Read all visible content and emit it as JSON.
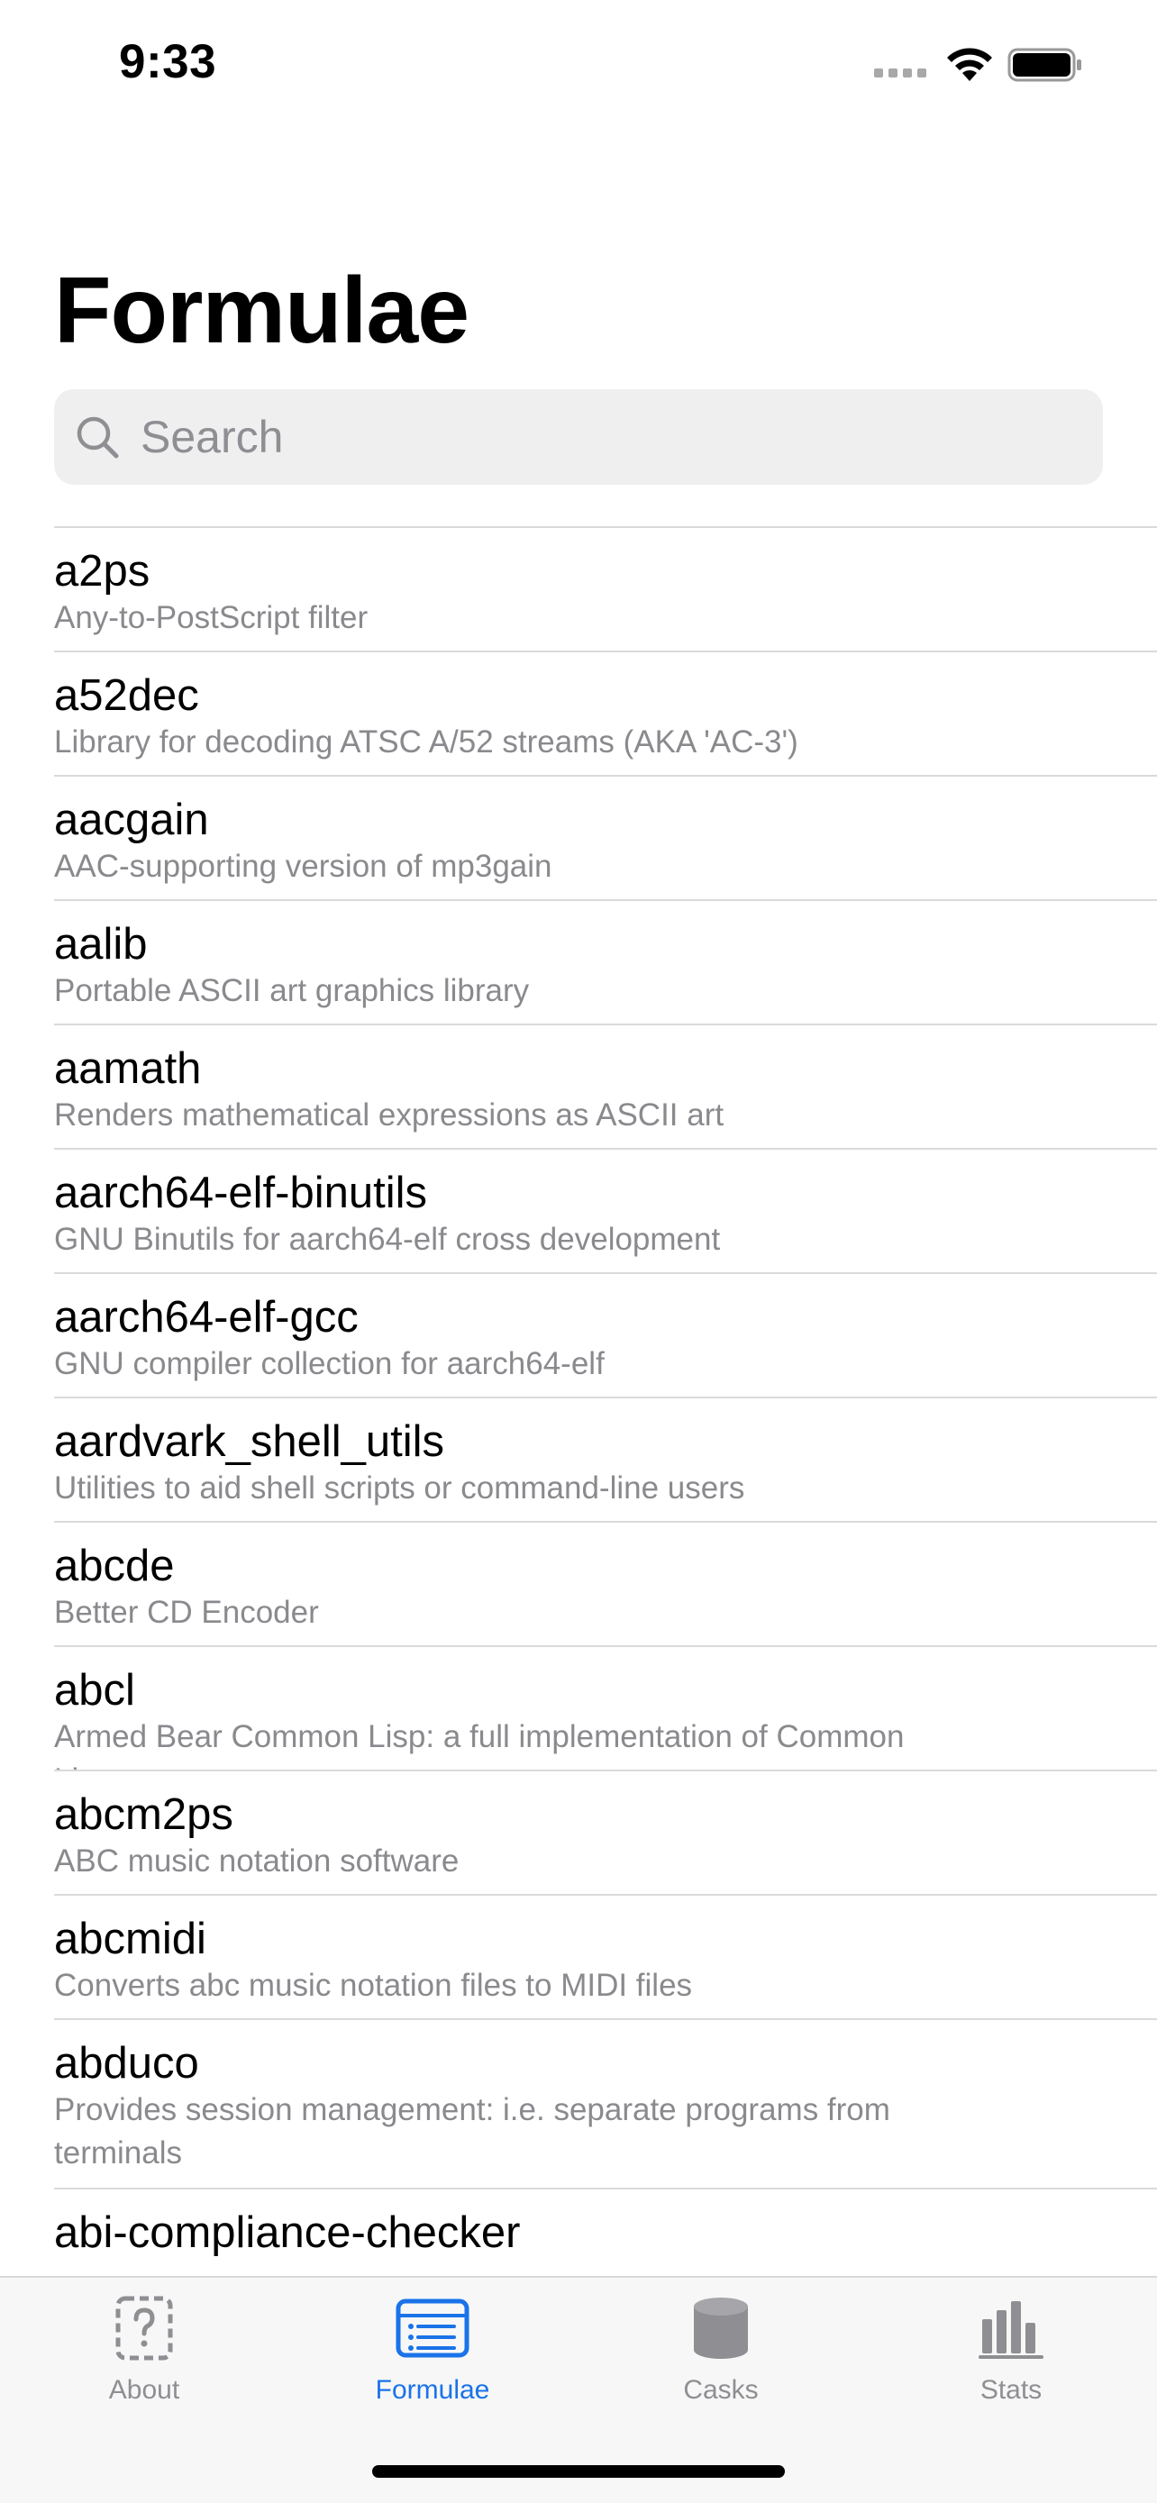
{
  "status_bar": {
    "time": "9:33"
  },
  "page": {
    "title": "Formulae"
  },
  "search": {
    "placeholder": "Search",
    "value": ""
  },
  "formulae": [
    {
      "name": "a2ps",
      "description": "Any-to-PostScript filter"
    },
    {
      "name": "a52dec",
      "description": "Library for decoding ATSC A/52 streams (AKA 'AC-3')"
    },
    {
      "name": "aacgain",
      "description": "AAC-supporting version of mp3gain"
    },
    {
      "name": "aalib",
      "description": "Portable ASCII art graphics library"
    },
    {
      "name": "aamath",
      "description": "Renders mathematical expressions as ASCII art"
    },
    {
      "name": "aarch64-elf-binutils",
      "description": "GNU Binutils for aarch64-elf cross development"
    },
    {
      "name": "aarch64-elf-gcc",
      "description": "GNU compiler collection for aarch64-elf"
    },
    {
      "name": "aardvark_shell_utils",
      "description": "Utilities to aid shell scripts or command-line users"
    },
    {
      "name": "abcde",
      "description": "Better CD Encoder"
    },
    {
      "name": "abcl",
      "description": "Armed Bear Common Lisp: a full implementation of Common Lisp"
    },
    {
      "name": "abcm2ps",
      "description": "ABC music notation software"
    },
    {
      "name": "abcmidi",
      "description": "Converts abc music notation files to MIDI files"
    },
    {
      "name": "abduco",
      "description": "Provides session management: i.e. separate programs from terminals"
    },
    {
      "name": "abi-compliance-checker",
      "description": ""
    }
  ],
  "tab_bar": {
    "active": "formulae",
    "accent_color": "#1a73e8",
    "inactive_color": "#8e8e93",
    "tabs": [
      {
        "id": "about",
        "label": "About",
        "icon": "question-mark-square-icon"
      },
      {
        "id": "formulae",
        "label": "Formulae",
        "icon": "list-icon"
      },
      {
        "id": "casks",
        "label": "Casks",
        "icon": "cylinder-icon"
      },
      {
        "id": "stats",
        "label": "Stats",
        "icon": "bar-chart-icon"
      }
    ]
  }
}
